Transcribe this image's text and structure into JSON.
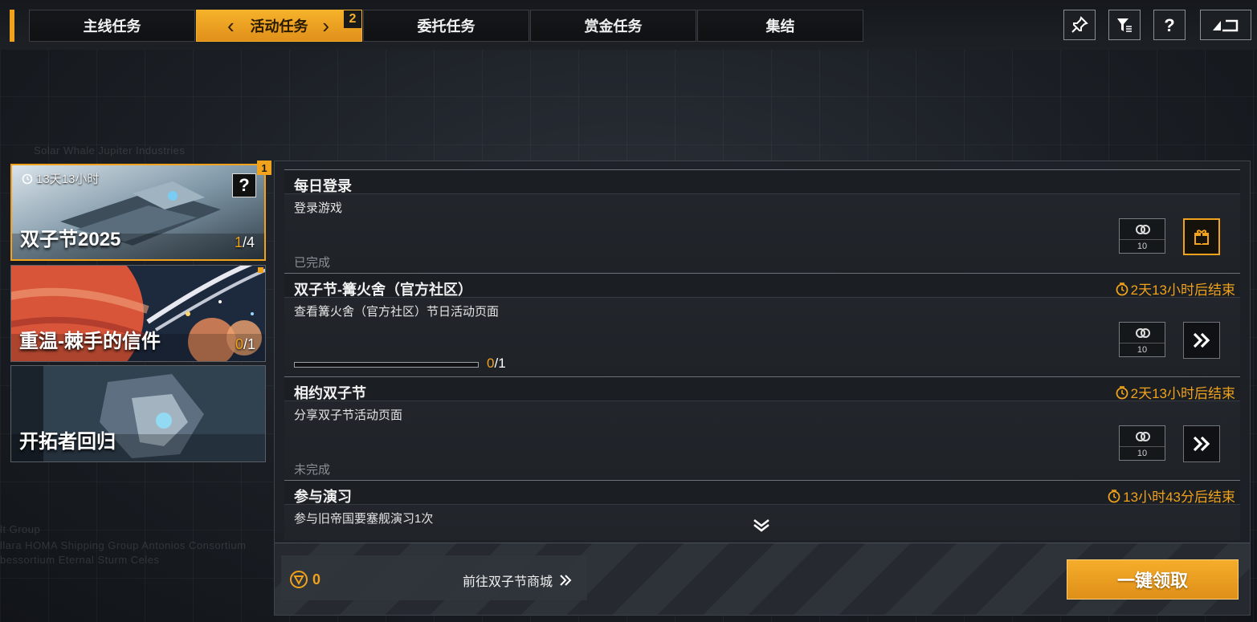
{
  "tabs": [
    {
      "label": "主线任务"
    },
    {
      "label": "活动任务",
      "badge": "2"
    },
    {
      "label": "委托任务"
    },
    {
      "label": "赏金任务"
    },
    {
      "label": "集结"
    }
  ],
  "toolbar": {
    "icons": [
      "pin-icon",
      "filter-icon",
      "help-icon",
      "back-icon"
    ]
  },
  "background_text": {
    "line1": "Solar Whale Jupiter Industries",
    "line2": "lt Group",
    "line3": "llara HOMA Shipping Group Antonios Consortium",
    "line4": "bessortium Eternal Sturm Celes"
  },
  "events": [
    {
      "title": "双子节2025",
      "progress_current": "1",
      "progress_total": "/4",
      "timer": "13天13小时",
      "help": "?",
      "badge": "1"
    },
    {
      "title": "重温-棘手的信件",
      "progress_current": "0",
      "progress_total": "/1"
    },
    {
      "title": "开拓者回归"
    }
  ],
  "tasks": [
    {
      "name": "每日登录",
      "desc": "登录游戏",
      "status": "已完成",
      "reward_amount": "10",
      "action": "gift-icon"
    },
    {
      "name": "双子节-篝火舍（官方社区）",
      "deadline": "2天13小时后结束",
      "desc": "查看篝火舍（官方社区）节日活动页面",
      "progress_current": "0",
      "progress_total": "/1",
      "progress_fraction": 0,
      "reward_amount": "10",
      "action": "go-icon"
    },
    {
      "name": "相约双子节",
      "deadline": "2天13小时后结束",
      "desc": "分享双子节活动页面",
      "status": "未完成",
      "reward_amount": "10",
      "action": "go-icon"
    },
    {
      "name": "参与演习",
      "deadline": "13小时43分后结束",
      "desc": "参与旧帝国要塞舰演习1次"
    }
  ],
  "bottom": {
    "currency_amount": "0",
    "shop_link": "前往双子节商城",
    "claim_all": "一键领取"
  },
  "colors": {
    "accent": "#f0a21c",
    "panel": "#1f2328",
    "text": "#e8e8e8"
  }
}
